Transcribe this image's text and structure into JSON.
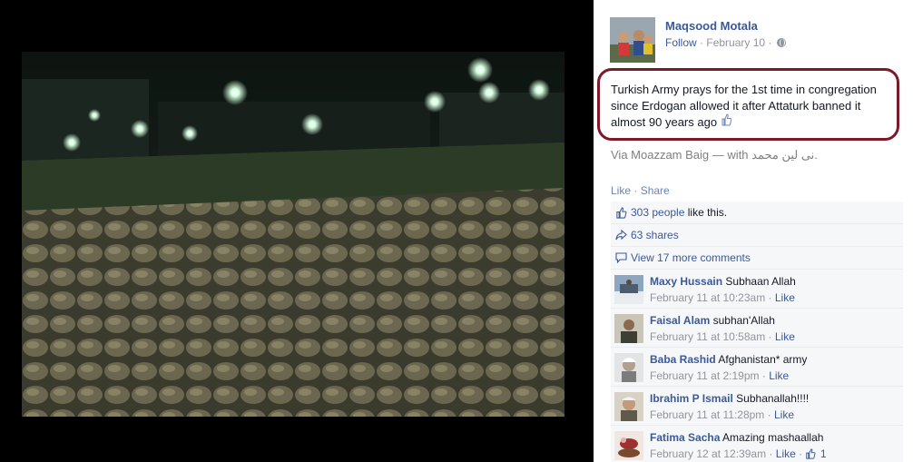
{
  "author": {
    "name": "Maqsood Motala",
    "follow_label": "Follow",
    "date": "February 10",
    "separator": "·"
  },
  "post": {
    "text": "Turkish Army prays for the 1st time in congregation since Erdogan allowed it after Attaturk banned it almost 90 years ago",
    "emoji_icon": "thumbs-up-outline-icon",
    "via_prefix": "Via Moazzam Baig —",
    "with_label": "with",
    "tagged_name": "نی لین محمد."
  },
  "actions": {
    "like": "Like",
    "dot": "·",
    "share": "Share"
  },
  "ufi": {
    "likes_count": "303 people",
    "likes_suffix": "like this.",
    "shares": "63 shares",
    "view_more": "View 17 more comments"
  },
  "comments": [
    {
      "name": "Maxy Hussain",
      "text": "Subhaan Allah",
      "time": "February 11 at 10:23am",
      "sep": "·",
      "like": "Like"
    },
    {
      "name": "Faisal Alam",
      "text": "subhan'Allah",
      "time": "February 11 at 10:58am",
      "sep": "·",
      "like": "Like"
    },
    {
      "name": "Baba Rashid",
      "text": "Afghanistan* army",
      "time": "February 11 at 2:19pm",
      "sep": "·",
      "like": "Like"
    },
    {
      "name": "Ibrahim P Ismail",
      "text": "Subhanallah!!!!",
      "time": "February 11 at 11:28pm",
      "sep": "·",
      "like": "Like"
    },
    {
      "name": "Fatima Sacha",
      "text": "Amazing mashaallah",
      "time": "February 12 at 12:39am",
      "sep": "·",
      "like": "Like",
      "sep2": "·",
      "like_count": "1"
    }
  ],
  "colors": {
    "link": "#3b5998",
    "highlight_border": "#7b1a2a",
    "panel_bg": "#f6f7f9"
  }
}
